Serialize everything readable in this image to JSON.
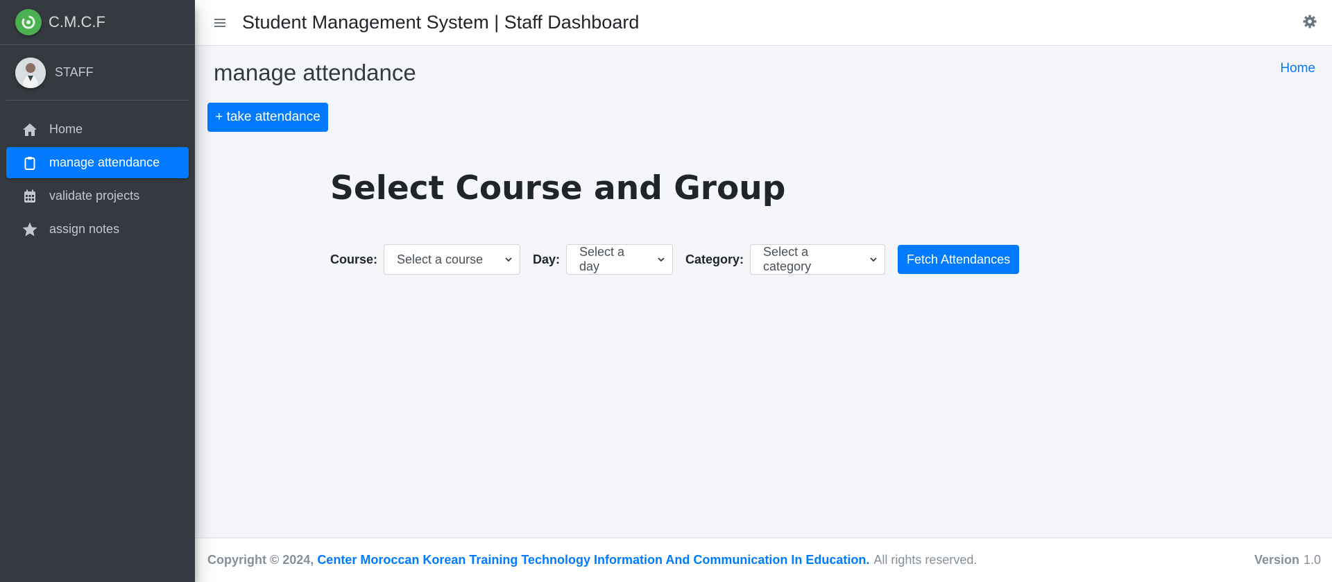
{
  "brand": {
    "text": "C.M.C.F"
  },
  "user": {
    "name": "STAFF"
  },
  "sidebar": {
    "items": [
      {
        "label": "Home",
        "icon": "home-icon",
        "active": false
      },
      {
        "label": "manage attendance",
        "icon": "clipboard-icon",
        "active": true
      },
      {
        "label": "validate projects",
        "icon": "calendar-icon",
        "active": false
      },
      {
        "label": "assign notes",
        "icon": "star-icon",
        "active": false
      }
    ]
  },
  "header": {
    "title": "Student Management System | Staff Dashboard"
  },
  "page": {
    "title": "manage attendance",
    "breadcrumb": "Home",
    "take_button": "+ take attendance",
    "section_title": "Select Course and Group"
  },
  "filters": {
    "course_label": "Course:",
    "course_selected": "Select a course",
    "day_label": "Day:",
    "day_selected": "Select a day",
    "category_label": "Category:",
    "category_selected": "Select a category",
    "fetch_button": "Fetch Attendances"
  },
  "footer": {
    "copyright": "Copyright © 2024,",
    "org": "Center Moroccan Korean Training Technology Information And Communication In Education.",
    "rights": "All rights reserved.",
    "version_label": "Version",
    "version_value": "1.0"
  },
  "colors": {
    "primary": "#007bff",
    "sidebar_bg": "#343a40",
    "content_bg": "#f4f6f9",
    "brand_logo": "#4caf50"
  }
}
